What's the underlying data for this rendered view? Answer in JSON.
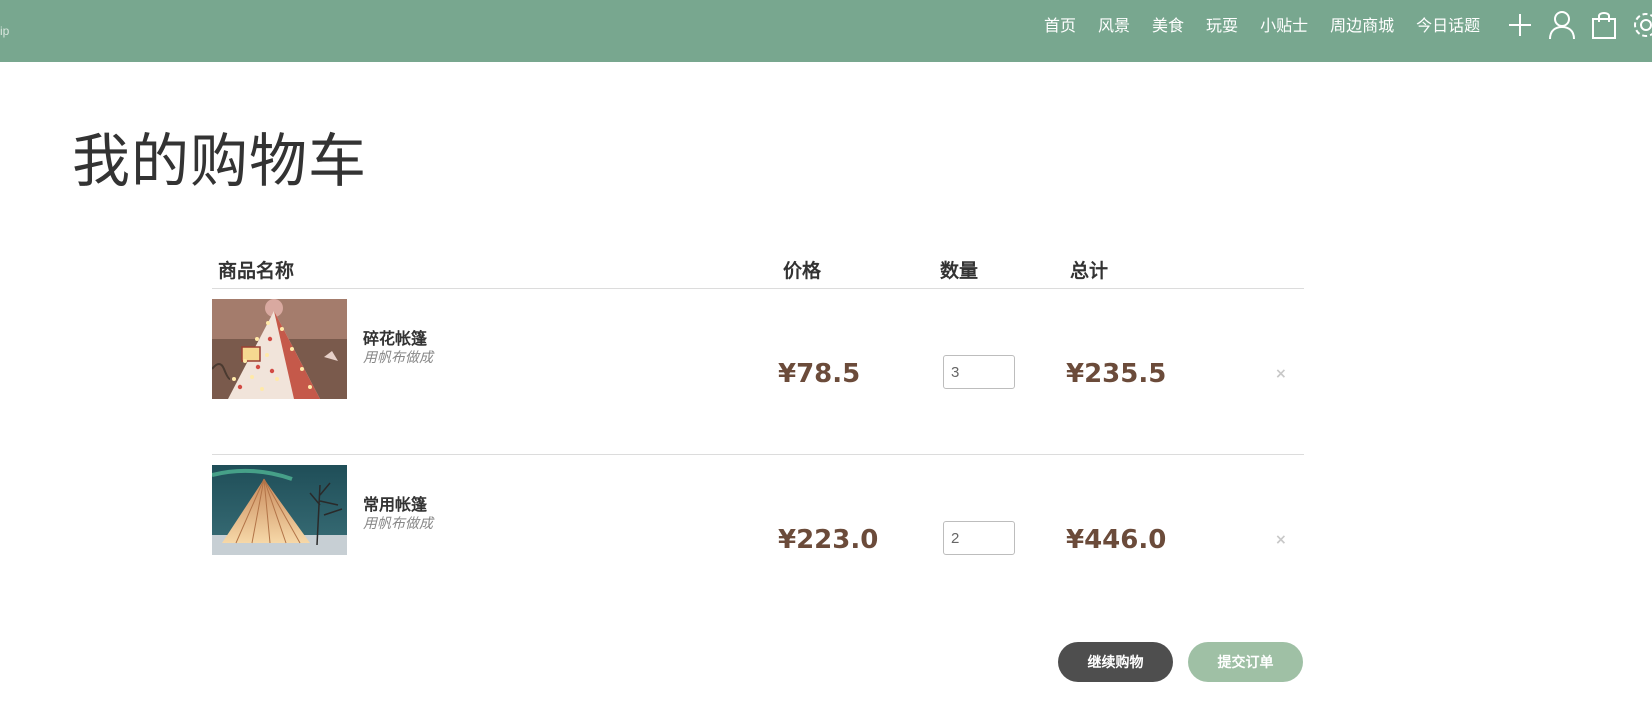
{
  "header": {
    "brand": "ip",
    "nav": [
      "首页",
      "风景",
      "美食",
      "玩耍",
      "小贴士",
      "周边商城",
      "今日话题"
    ],
    "icons": [
      "plus-icon",
      "user-icon",
      "shopping-bag-icon",
      "settings-icon"
    ]
  },
  "page": {
    "title": "我的购物车"
  },
  "table": {
    "headers": {
      "name": "商品名称",
      "price": "价格",
      "quantity": "数量",
      "total": "总计"
    },
    "items": [
      {
        "name": "碎花帐篷",
        "desc": "用帆布做成",
        "price": "¥78.5",
        "quantity": "3",
        "total": "¥235.5",
        "remove": "×"
      },
      {
        "name": "常用帐篷",
        "desc": "用帆布做成",
        "price": "¥223.0",
        "quantity": "2",
        "total": "¥446.0",
        "remove": "×"
      }
    ]
  },
  "actions": {
    "continue": "继续购物",
    "submit": "提交订单"
  },
  "colors": {
    "header_bg": "#78a78f",
    "price": "#6b4b3a",
    "continue_bg": "#4e4e4e",
    "submit_bg": "#9fc0a5"
  }
}
